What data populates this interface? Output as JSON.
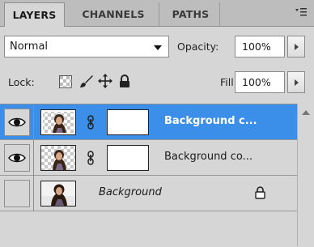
{
  "tabs": [
    {
      "label": "LAYERS",
      "active": true
    },
    {
      "label": "CHANNELS",
      "active": false
    },
    {
      "label": "PATHS",
      "active": false
    }
  ],
  "blend_mode": {
    "value": "Normal"
  },
  "opacity": {
    "label": "Opacity:",
    "value": "100%"
  },
  "lock": {
    "label": "Lock:",
    "icons": [
      "lock-transparent-pixels-icon",
      "lock-image-pixels-icon",
      "lock-position-icon",
      "lock-all-icon"
    ]
  },
  "fill": {
    "label": "Fill:",
    "value": "100%"
  },
  "layers": [
    {
      "name": "Background c...",
      "visible": true,
      "selected": true,
      "has_mask": true,
      "locked": false
    },
    {
      "name": "Background co...",
      "visible": true,
      "selected": false,
      "has_mask": true,
      "locked": false
    },
    {
      "name": "Background",
      "visible": false,
      "selected": false,
      "has_mask": false,
      "locked": true
    }
  ],
  "colors": {
    "selection": "#3b8fe8",
    "panel_bg": "#d6d6d6"
  }
}
